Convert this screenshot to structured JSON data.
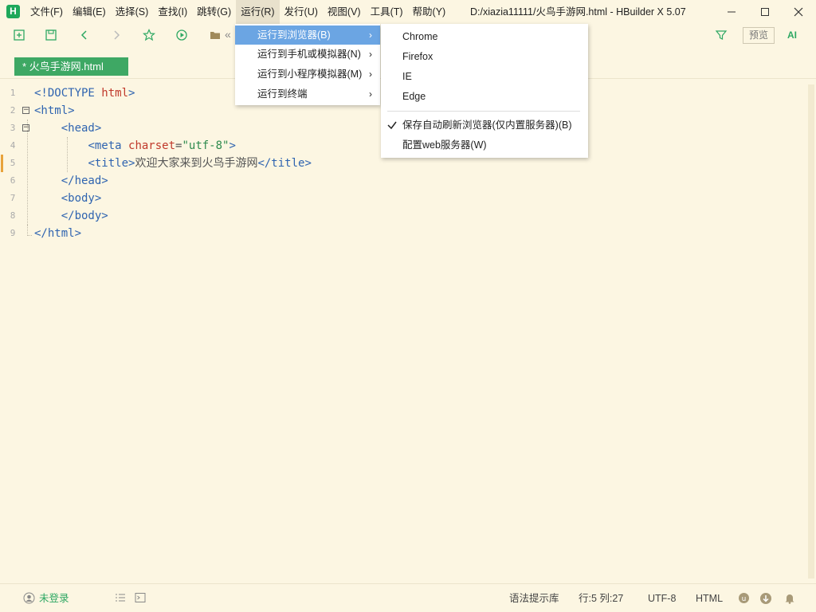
{
  "menubar": {
    "items": [
      "文件(F)",
      "编辑(E)",
      "选择(S)",
      "查找(I)",
      "跳转(G)",
      "运行(R)",
      "发行(U)",
      "视图(V)",
      "工具(T)",
      "帮助(Y)"
    ],
    "title": "D:/xiazia11111/火鸟手游网.html - HBuilder X 5.07"
  },
  "toolbar": {
    "path_prefix": "«",
    "preview_label": "预览",
    "ai_label": "AI"
  },
  "tab": {
    "label": "* 火鸟手游网.html"
  },
  "editor": {
    "line_numbers": [
      "1",
      "2",
      "3",
      "4",
      "5",
      "6",
      "7",
      "8",
      "9"
    ],
    "lines": [
      {
        "indent": "",
        "t1": "<!DOCTYPE ",
        "a1": "html",
        "t2": ">",
        "s": "",
        "t3": "",
        "x": "",
        "t4": ""
      },
      {
        "indent": "",
        "t1": "<html>",
        "a1": "",
        "t2": "",
        "s": "",
        "t3": "",
        "x": "",
        "t4": ""
      },
      {
        "indent": "    ",
        "t1": "<head>",
        "a1": "",
        "t2": "",
        "s": "",
        "t3": "",
        "x": "",
        "t4": ""
      },
      {
        "indent": "        ",
        "t1": "<meta ",
        "a1": "charset",
        "t2": "=",
        "s": "\"utf-8\"",
        "t3": ">",
        "x": "",
        "t4": ""
      },
      {
        "indent": "        ",
        "t1": "<title>",
        "a1": "",
        "t2": "",
        "s": "",
        "t3": "",
        "x": "欢迎大家来到火鸟手游网",
        "t4": "</title>"
      },
      {
        "indent": "    ",
        "t1": "</head>",
        "a1": "",
        "t2": "",
        "s": "",
        "t3": "",
        "x": "",
        "t4": ""
      },
      {
        "indent": "    ",
        "t1": "<body>",
        "a1": "",
        "t2": "",
        "s": "",
        "t3": "",
        "x": "",
        "t4": ""
      },
      {
        "indent": "    ",
        "t1": "</body>",
        "a1": "",
        "t2": "",
        "s": "",
        "t3": "",
        "x": "",
        "t4": ""
      },
      {
        "indent": "",
        "t1": "</html>",
        "a1": "",
        "t2": "",
        "s": "",
        "t3": "",
        "x": "",
        "t4": ""
      }
    ]
  },
  "run_menu": {
    "items": [
      "运行到浏览器(B)",
      "运行到手机或模拟器(N)",
      "运行到小程序模拟器(M)",
      "运行到终端"
    ]
  },
  "browser_menu": {
    "browsers": [
      "Chrome",
      "Firefox",
      "IE",
      "Edge"
    ],
    "auto_refresh": "保存自动刷新浏览器(仅内置服务器)(B)",
    "web_server": "配置web服务器(W)"
  },
  "statusbar": {
    "login": "未登录",
    "syntax": "语法提示库",
    "position": "行:5  列:27",
    "encoding": "UTF-8",
    "language": "HTML"
  },
  "colors": {
    "brand": "#1ea85a",
    "tab_bg": "#3ea864",
    "menu_highlight": "#6ba5e3",
    "background": "#fcf6e2"
  }
}
